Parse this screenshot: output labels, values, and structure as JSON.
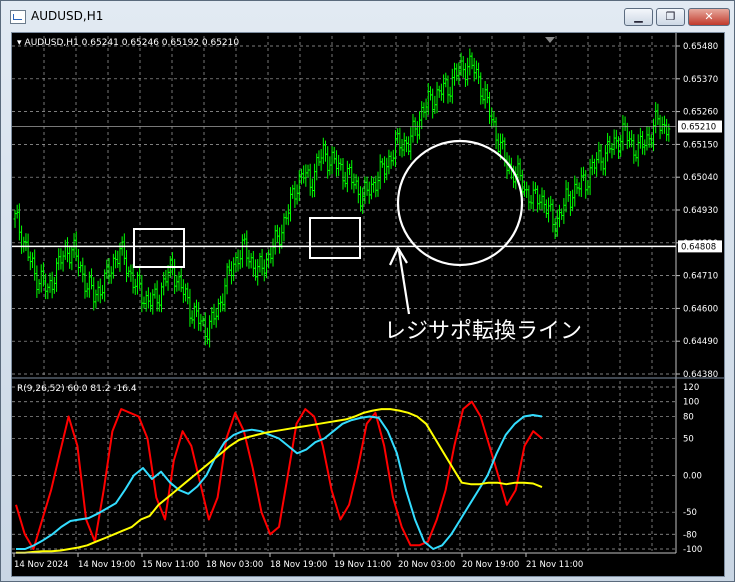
{
  "window": {
    "title": "AUDUSD,H1",
    "minimize_icon": "minimize-icon",
    "maximize_icon": "maximize-icon",
    "close_icon": "close-icon"
  },
  "main_chart": {
    "header": "AUDUSD,H1  0.65241 0.65246 0.65192 0.65210",
    "price_labels": [
      "0.65480",
      "0.65370",
      "0.65260",
      "0.65150",
      "0.65040",
      "0.64930",
      "0.64820",
      "0.64710",
      "0.64600",
      "0.64490",
      "0.64380"
    ],
    "current_price_label": "0.65210",
    "hline_price_label": "0.64808",
    "annotation_text": "レジサポ転換ライン",
    "colors": {
      "candles": "#00ff00",
      "grid": "#c0c0c0",
      "background": "#000000",
      "markup": "#ffffff"
    }
  },
  "indicator": {
    "header": "R(9,26,52) 60.0 81.2 -16.4",
    "scale_labels": [
      "120",
      "100",
      "80",
      "50",
      "0.00",
      "-50",
      "-80",
      "-100"
    ],
    "colors": {
      "red_line": "#ff0000",
      "cyan_line": "#33ddff",
      "yellow_line": "#ffff00"
    }
  },
  "time_axis": [
    "14 Nov 2024",
    "14 Nov 19:00",
    "15 Nov 11:00",
    "18 Nov 03:00",
    "18 Nov 19:00",
    "19 Nov 11:00",
    "20 Nov 03:00",
    "20 Nov 19:00",
    "21 Nov 11:00"
  ],
  "chart_data": {
    "type": "line",
    "symbol": "AUDUSD",
    "timeframe": "H1",
    "ohlc_last": {
      "open": 0.65241,
      "high": 0.65246,
      "low": 0.65192,
      "close": 0.6521
    },
    "ylim": [
      0.6438,
      0.6548
    ],
    "horizontal_line": 0.64808,
    "close_series": [
      0.649,
      0.6485,
      0.6478,
      0.6471,
      0.647,
      0.6465,
      0.6472,
      0.6476,
      0.648,
      0.6479,
      0.6473,
      0.6468,
      0.6464,
      0.6467,
      0.647,
      0.6476,
      0.6479,
      0.6475,
      0.6469,
      0.6466,
      0.6463,
      0.6462,
      0.6465,
      0.647,
      0.6474,
      0.6468,
      0.6464,
      0.6459,
      0.6456,
      0.6453,
      0.6455,
      0.646,
      0.6468,
      0.6473,
      0.6478,
      0.648,
      0.6476,
      0.6472,
      0.6475,
      0.6479,
      0.6483,
      0.6489,
      0.6495,
      0.6502,
      0.6505,
      0.6502,
      0.6508,
      0.6512,
      0.651,
      0.6508,
      0.6506,
      0.6504,
      0.6501,
      0.6497,
      0.65,
      0.6503,
      0.6506,
      0.651,
      0.6514,
      0.6516,
      0.6515,
      0.652,
      0.6526,
      0.6529,
      0.6531,
      0.6533,
      0.6534,
      0.6538,
      0.654,
      0.6542,
      0.654,
      0.6535,
      0.6528,
      0.6521,
      0.6514,
      0.6508,
      0.6506,
      0.6503,
      0.6499,
      0.6496,
      0.6498,
      0.6494,
      0.6489,
      0.6491,
      0.6496,
      0.6499,
      0.6501,
      0.6503,
      0.6507,
      0.651,
      0.6512,
      0.6514,
      0.6517,
      0.6519,
      0.6515,
      0.6513,
      0.6516,
      0.6519,
      0.6523,
      0.6521
    ],
    "indicator_scale": [
      -100,
      120
    ],
    "indicator_series": [
      {
        "name": "R(9,26,52)",
        "values": [
          -40,
          -80,
          -100,
          -60,
          -20,
          30,
          80,
          40,
          -60,
          -90,
          -20,
          60,
          90,
          85,
          80,
          50,
          -30,
          -60,
          20,
          60,
          40,
          -10,
          -60,
          -30,
          50,
          85,
          60,
          10,
          -50,
          -80,
          -70,
          0,
          70,
          90,
          80,
          40,
          -20,
          -60,
          -40,
          10,
          70,
          85,
          40,
          -30,
          -70,
          -95,
          -95,
          -90,
          -60,
          -20,
          40,
          90,
          100,
          80,
          40,
          0,
          -40,
          -20,
          40,
          60,
          50
        ]
      },
      {
        "name": "",
        "values": [
          -100,
          -100,
          -95,
          -88,
          -80,
          -70,
          -62,
          -60,
          -58,
          -52,
          -45,
          -38,
          -20,
          0,
          10,
          -5,
          5,
          -10,
          -20,
          -25,
          -15,
          0,
          25,
          45,
          55,
          60,
          62,
          60,
          55,
          50,
          40,
          30,
          35,
          45,
          50,
          60,
          70,
          75,
          78,
          80,
          78,
          60,
          30,
          -20,
          -60,
          -90,
          -100,
          -95,
          -80,
          -60,
          -40,
          -20,
          0,
          30,
          55,
          70,
          80,
          82,
          80
        ]
      },
      {
        "name": "",
        "values": [
          -105,
          -105,
          -104,
          -103,
          -103,
          -102,
          -100,
          -98,
          -95,
          -90,
          -85,
          -80,
          -75,
          -70,
          -60,
          -55,
          -40,
          -30,
          -20,
          -10,
          0,
          10,
          20,
          30,
          40,
          48,
          52,
          55,
          58,
          60,
          62,
          64,
          66,
          68,
          70,
          72,
          74,
          76,
          80,
          85,
          88,
          90,
          90,
          88,
          85,
          80,
          70,
          50,
          30,
          10,
          -10,
          -12,
          -12,
          -10,
          -10,
          -12,
          -10,
          -10,
          -11,
          -16
        ]
      }
    ],
    "indicator_last_values": [
      60.0,
      81.2,
      -16.4
    ]
  }
}
